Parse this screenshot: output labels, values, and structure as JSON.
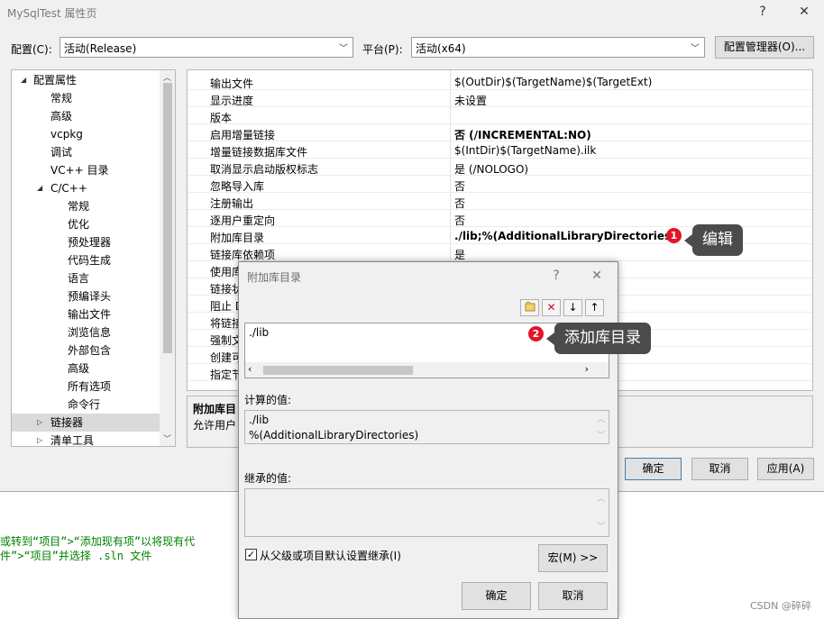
{
  "window": {
    "title": "MySqlTest 属性页",
    "help": "?",
    "close": "✕"
  },
  "config": {
    "label": "配置(C):",
    "value": "活动(Release)",
    "platform_label": "平台(P):",
    "platform_value": "活动(x64)",
    "manager_button": "配置管理器(O)..."
  },
  "tree": [
    {
      "label": "配置属性",
      "toggle": "◢"
    },
    {
      "label": "常规"
    },
    {
      "label": "高级"
    },
    {
      "label": "vcpkg"
    },
    {
      "label": "调试"
    },
    {
      "label": "VC++ 目录"
    },
    {
      "label": "C/C++",
      "toggle": "◢"
    },
    {
      "label": "常规"
    },
    {
      "label": "优化"
    },
    {
      "label": "预处理器"
    },
    {
      "label": "代码生成"
    },
    {
      "label": "语言"
    },
    {
      "label": "预编译头"
    },
    {
      "label": "输出文件"
    },
    {
      "label": "浏览信息"
    },
    {
      "label": "外部包含"
    },
    {
      "label": "高级"
    },
    {
      "label": "所有选项"
    },
    {
      "label": "命令行"
    },
    {
      "label": "链接器",
      "toggle": "▷"
    },
    {
      "label": "清单工具",
      "toggle": "▷"
    }
  ],
  "grid": [
    {
      "name": "输出文件",
      "value": "$(OutDir)$(TargetName)$(TargetExt)"
    },
    {
      "name": "显示进度",
      "value": "未设置"
    },
    {
      "name": "版本",
      "value": ""
    },
    {
      "name": "启用增量链接",
      "value": "否 (/INCREMENTAL:NO)"
    },
    {
      "name": "增量链接数据库文件",
      "value": "$(IntDir)$(TargetName).ilk"
    },
    {
      "name": "取消显示启动版权标志",
      "value": "是 (/NOLOGO)"
    },
    {
      "name": "忽略导入库",
      "value": "否"
    },
    {
      "name": "注册输出",
      "value": "否"
    },
    {
      "name": "逐用户重定向",
      "value": "否"
    },
    {
      "name": "附加库目录",
      "value": "./lib;%(AdditionalLibraryDirectories)"
    },
    {
      "name": "链接库依赖项",
      "value": "是"
    },
    {
      "name": "使用库",
      "value": ""
    },
    {
      "name": "链接状",
      "value": ""
    },
    {
      "name": "阻止 D",
      "value": ""
    },
    {
      "name": "将链接",
      "value": ""
    },
    {
      "name": "强制文",
      "value": ""
    },
    {
      "name": "创建可",
      "value": ""
    },
    {
      "name": "指定节",
      "value": ""
    }
  ],
  "description": {
    "title": "附加库目",
    "text": "允许用户"
  },
  "buttons": {
    "ok": "确定",
    "cancel": "取消",
    "apply": "应用(A)"
  },
  "code_lines": [
    "或转到“项目”>“添加现有项”以将现有代",
    "件”>“项目”并选择 .sln 文件"
  ],
  "dialog": {
    "title": "附加库目录",
    "help": "?",
    "close": "✕",
    "dirs": [
      "./lib"
    ],
    "computed_label": "计算的值:",
    "computed": [
      "./lib",
      "%(AdditionalLibraryDirectories)"
    ],
    "inherited_label": "继承的值:",
    "inherit_checkbox": "从父级或项目默认设置继承(I)",
    "macro_button": "宏(M) >>",
    "ok": "确定",
    "cancel": "取消"
  },
  "callouts": [
    {
      "number": "1",
      "text": "编辑"
    },
    {
      "number": "2",
      "text": "添加库目录"
    }
  ],
  "watermark": "CSDN @碎碎"
}
